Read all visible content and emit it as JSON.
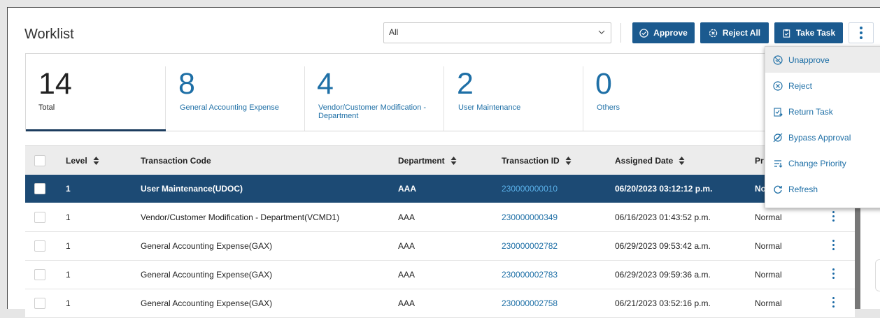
{
  "header": {
    "title": "Worklist"
  },
  "filter": {
    "value": "All"
  },
  "actions": {
    "approve": "Approve",
    "reject_all": "Reject All",
    "take_task": "Take Task"
  },
  "summary": [
    {
      "count": "14",
      "label": "Total"
    },
    {
      "count": "8",
      "label": "General Accounting Expense"
    },
    {
      "count": "4",
      "label": "Vendor/Customer Modification - Department"
    },
    {
      "count": "2",
      "label": "User Maintenance"
    },
    {
      "count": "0",
      "label": "Others"
    }
  ],
  "table": {
    "columns": [
      "Level",
      "Transaction Code",
      "Department",
      "Transaction ID",
      "Assigned Date",
      "Pr"
    ],
    "rows": [
      {
        "level": "1",
        "code": "User Maintenance(UDOC)",
        "dept": "AAA",
        "tid": "230000000010",
        "date": "06/20/2023 03:12:12 p.m.",
        "priority": "No"
      },
      {
        "level": "1",
        "code": "Vendor/Customer Modification - Department(VCMD1)",
        "dept": "AAA",
        "tid": "230000000349",
        "date": "06/16/2023 01:43:52 p.m.",
        "priority": "Normal"
      },
      {
        "level": "1",
        "code": "General Accounting Expense(GAX)",
        "dept": "AAA",
        "tid": "230000002782",
        "date": "06/29/2023 09:53:42 a.m.",
        "priority": "Normal"
      },
      {
        "level": "1",
        "code": "General Accounting Expense(GAX)",
        "dept": "AAA",
        "tid": "230000002783",
        "date": "06/29/2023 09:59:36 a.m.",
        "priority": "Normal"
      },
      {
        "level": "1",
        "code": "General Accounting Expense(GAX)",
        "dept": "AAA",
        "tid": "230000002758",
        "date": "06/21/2023 03:52:16 p.m.",
        "priority": "Normal"
      }
    ]
  },
  "menu": [
    {
      "label": "Unapprove",
      "icon": "unapprove-icon"
    },
    {
      "label": "Reject",
      "icon": "reject-icon"
    },
    {
      "label": "Return Task",
      "icon": "return-task-icon"
    },
    {
      "label": "Bypass Approval",
      "icon": "bypass-icon"
    },
    {
      "label": "Change Priority",
      "icon": "priority-icon"
    },
    {
      "label": "Refresh",
      "icon": "refresh-icon"
    }
  ],
  "colors": {
    "accent": "#1b5a8f",
    "link": "#1e6fa6",
    "selected_row": "#1c4a74"
  }
}
